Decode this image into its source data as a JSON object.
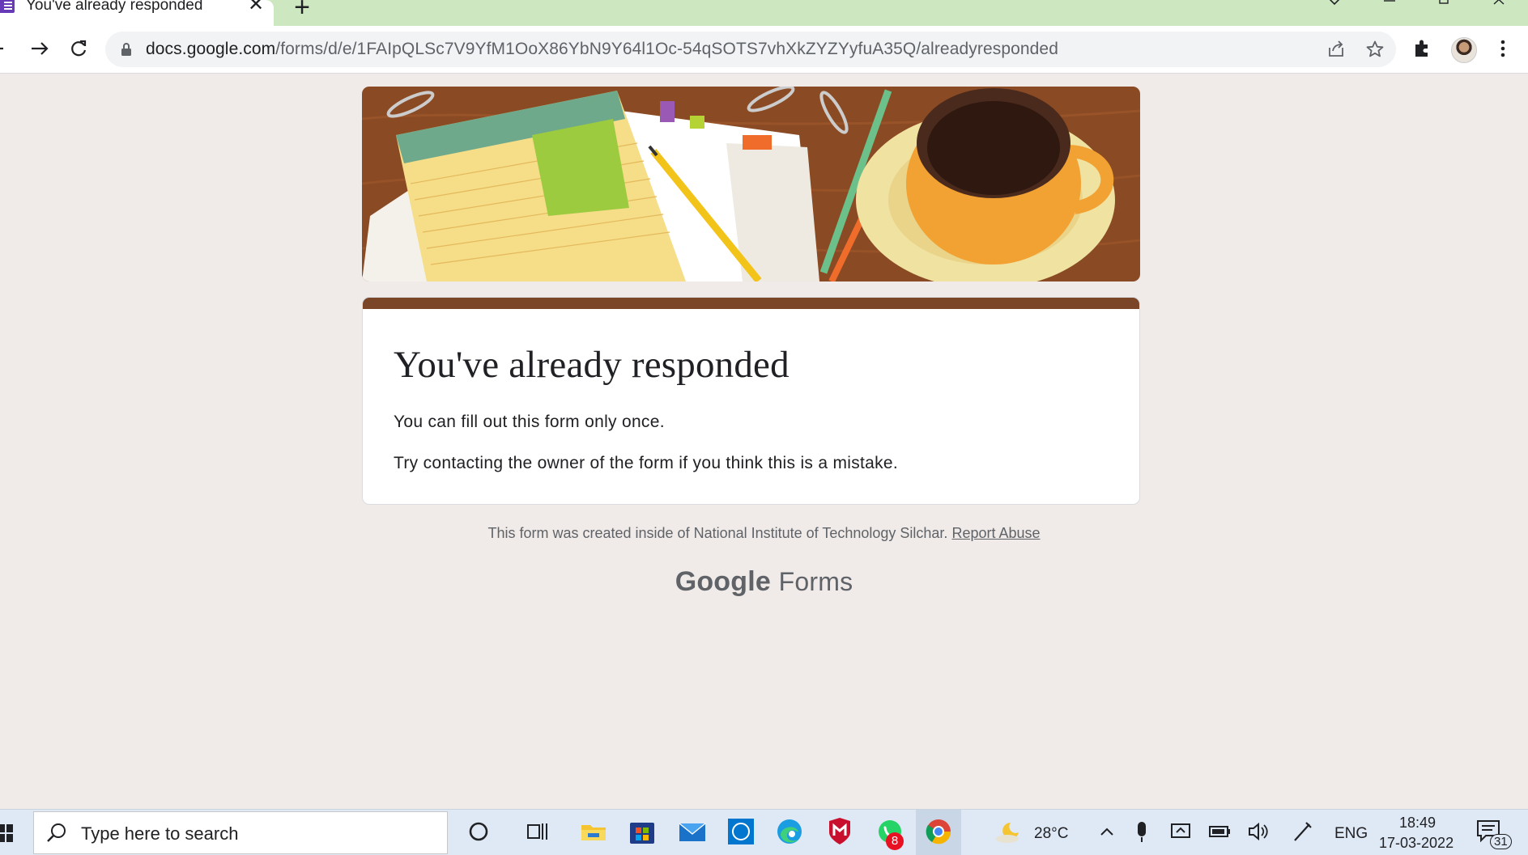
{
  "browser": {
    "tab_title": "You've already responded",
    "tab_close": "✕",
    "new_tab": "+",
    "url_host": "docs.google.com",
    "url_path": "/forms/d/e/1FAIpQLSc7V9YfM1OoX86YbN9Y64l1Oc-54qSOTS7vhXkZYZYyfuA35Q/alreadyresponded"
  },
  "page": {
    "title": "You've already responded",
    "message_1": "You can fill out this form only once.",
    "message_2": "Try contacting the owner of the form if you think this is a mistake.",
    "footer_text": "This form was created inside of National Institute of Technology Silchar.",
    "report_link": "Report Abuse",
    "brand_google": "Google",
    "brand_forms": "Forms",
    "accent_color": "#7b4527"
  },
  "taskbar": {
    "search_placeholder": "Type here to search",
    "whatsapp_badge": "8",
    "temperature": "28°C",
    "language": "ENG",
    "time": "18:49",
    "date": "17-03-2022",
    "notification_count": "31"
  }
}
